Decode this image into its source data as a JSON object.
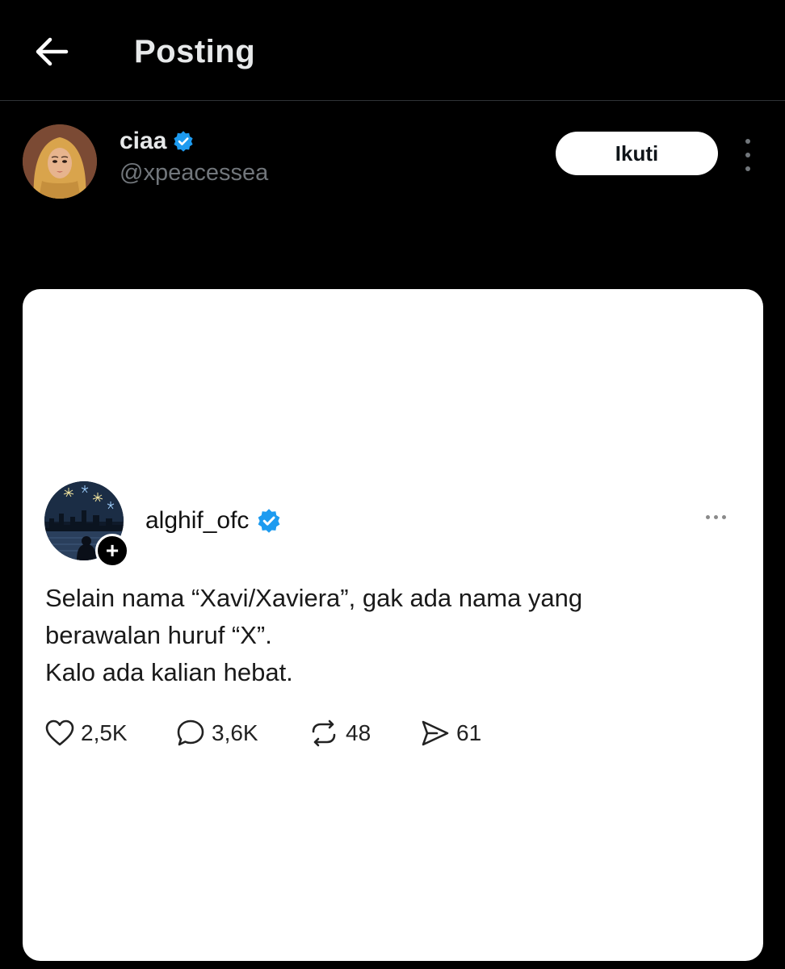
{
  "header": {
    "title": "Posting",
    "back_icon": "arrow-left-icon"
  },
  "post": {
    "author": {
      "name": "ciaa",
      "handle": "@xpeacessea",
      "verified": true,
      "verified_color": "#1d9bf0"
    },
    "follow_label": "Ikuti",
    "more_icon": "more-vertical-icon",
    "media": {
      "background": "#ffffff",
      "author": {
        "name": "alghif_ofc",
        "verified": true
      },
      "text_lines": [
        "Selain nama “Xavi/Xaviera”, gak ada nama yang",
        "berawalan huruf “X”.",
        "Kalo ada kalian hebat."
      ],
      "stats": {
        "likes": "2,5K",
        "comments": "3,6K",
        "reposts": "48",
        "shares": "61"
      }
    }
  }
}
